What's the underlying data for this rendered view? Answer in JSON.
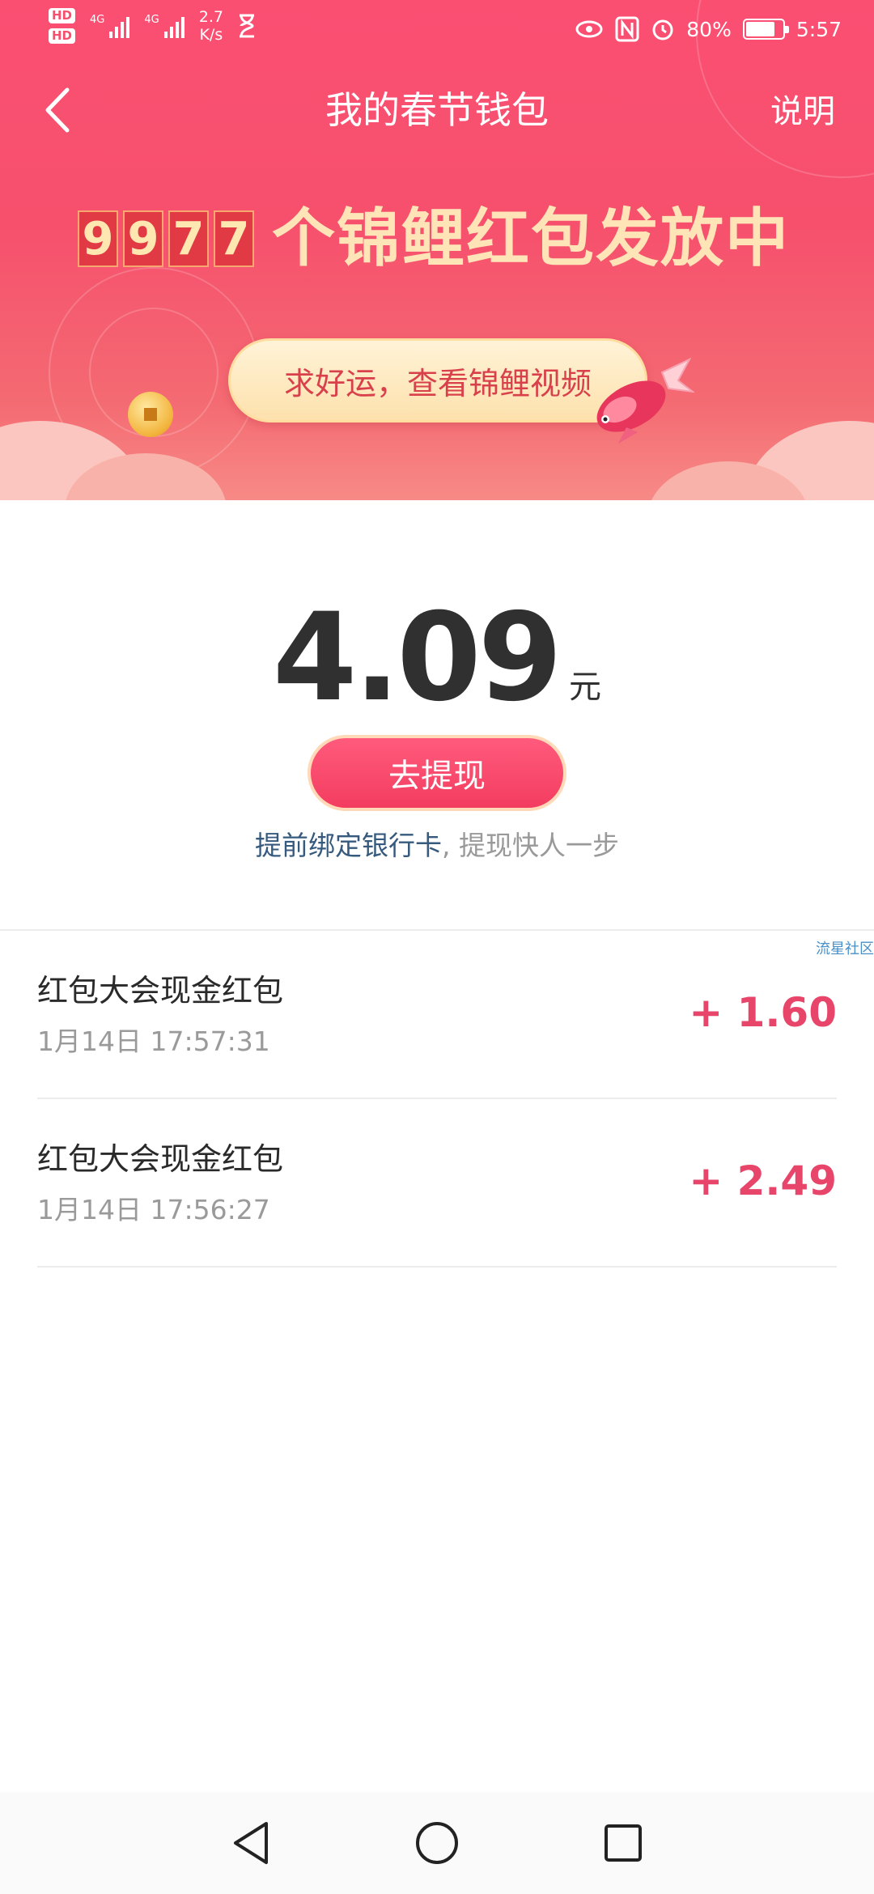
{
  "status_bar": {
    "hd1": "HD",
    "hd2": "HD",
    "net1": "4G",
    "net2": "4G",
    "speed_value": "2.7",
    "speed_unit": "K/s",
    "battery": "80%",
    "battery_level": 0.8,
    "time": "5:57",
    "icons": [
      "eye-icon",
      "nfc-icon",
      "alarm-icon",
      "hourglass-icon"
    ]
  },
  "header": {
    "title": "我的春节钱包",
    "help": "说明"
  },
  "banner": {
    "counter_digits": [
      "9",
      "9",
      "7",
      "7"
    ],
    "headline": "个锦鲤红包发放中",
    "video_button": "求好运，查看锦鲤视频"
  },
  "balance": {
    "amount": "4.09",
    "unit": "元",
    "withdraw_button": "去提现",
    "bind_link": "提前绑定银行卡",
    "bind_rest": ", 提现快人一步"
  },
  "watermark": "流星社区",
  "transactions": [
    {
      "title": "红包大会现金红包",
      "time": "1月14日 17:57:31",
      "amount": "+ 1.60"
    },
    {
      "title": "红包大会现金红包",
      "time": "1月14日 17:56:27",
      "amount": "+ 2.49"
    }
  ],
  "colors": {
    "brand": "#f6506d",
    "amount_pink": "#e8456a",
    "link_blue": "#365a7e",
    "headline_gold": "#ffe4b8"
  }
}
